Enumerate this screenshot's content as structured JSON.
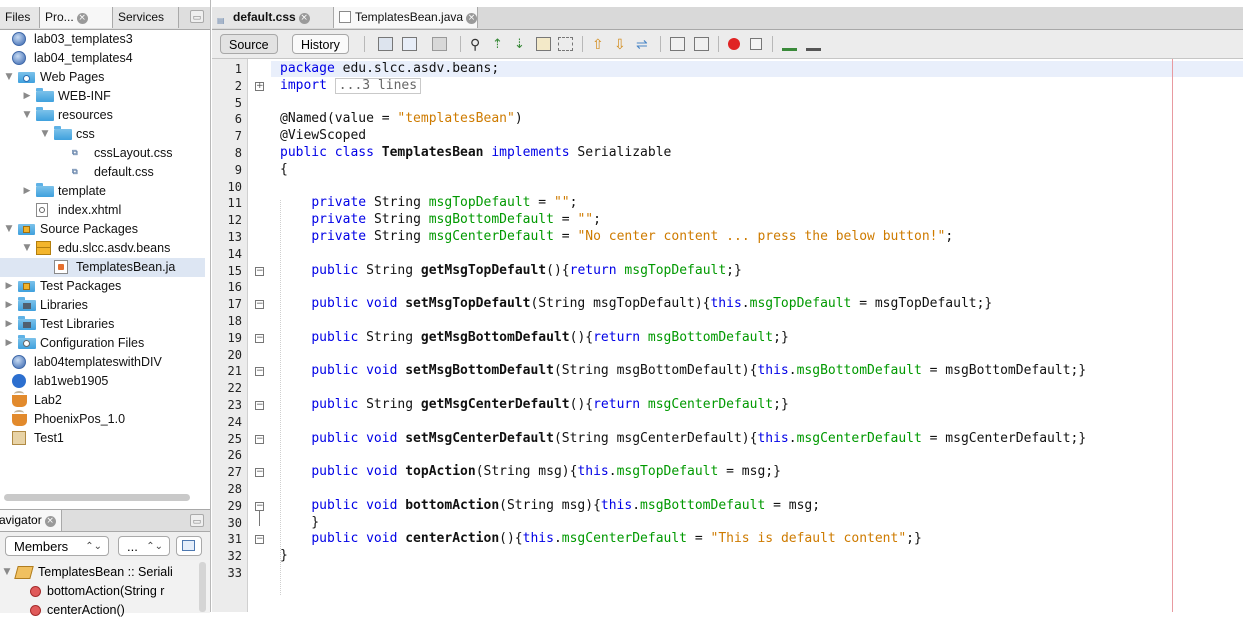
{
  "left_tabs": [
    {
      "label": "Files"
    },
    {
      "label": "Pro..."
    },
    {
      "label": "Services"
    }
  ],
  "tree": [
    {
      "label": "lab03_templates3",
      "icon": "globe-icon"
    },
    {
      "label": "lab04_templates4",
      "icon": "globe-icon"
    },
    {
      "label": "Web Pages",
      "icon": "web-pages-icon",
      "toggle": "expanded"
    },
    {
      "label": "WEB-INF",
      "icon": "folder-icon",
      "toggle": "collapsed"
    },
    {
      "label": "resources",
      "icon": "folder-icon",
      "toggle": "expanded"
    },
    {
      "label": "css",
      "icon": "folder-icon",
      "toggle": "expanded"
    },
    {
      "label": "cssLayout.css",
      "icon": "css-file-icon"
    },
    {
      "label": "default.css",
      "icon": "css-file-icon"
    },
    {
      "label": "template",
      "icon": "folder-icon",
      "toggle": "collapsed"
    },
    {
      "label": "index.xhtml",
      "icon": "xhtml-file-icon"
    },
    {
      "label": "Source Packages",
      "icon": "source-packages-icon",
      "toggle": "expanded"
    },
    {
      "label": "edu.slcc.asdv.beans",
      "icon": "package-icon",
      "toggle": "expanded"
    },
    {
      "label": "TemplatesBean.ja",
      "icon": "java-file-icon"
    },
    {
      "label": "Test Packages",
      "icon": "test-packages-icon",
      "toggle": "collapsed"
    },
    {
      "label": "Libraries",
      "icon": "libraries-icon",
      "toggle": "collapsed"
    },
    {
      "label": "Test Libraries",
      "icon": "libraries-icon",
      "toggle": "collapsed"
    },
    {
      "label": "Configuration Files",
      "icon": "config-files-icon",
      "toggle": "collapsed"
    },
    {
      "label": "lab04templateswithDIV",
      "icon": "globe-icon"
    },
    {
      "label": "lab1web1905",
      "icon": "web-project-icon"
    },
    {
      "label": "Lab2",
      "icon": "java-cup-icon"
    },
    {
      "label": "PhoenixPos_1.0",
      "icon": "java-cup-icon"
    },
    {
      "label": "Test1",
      "icon": "test-project-icon"
    }
  ],
  "navigator": {
    "title": "avigator",
    "filter_select": "Members",
    "second_select": "...",
    "items": [
      {
        "label": "TemplatesBean :: Seriali"
      },
      {
        "label": "bottomAction(String r"
      },
      {
        "label": "centerAction()"
      }
    ]
  },
  "editor_tabs": [
    {
      "label": "default.css"
    },
    {
      "label": "TemplatesBean.java"
    }
  ],
  "toolbar": {
    "source_label": "Source",
    "history_label": "History"
  },
  "code_lines": [
    {
      "n": "1",
      "seg": [
        [
          "kw",
          "package "
        ],
        [
          "",
          "edu.slcc.asdv.beans;"
        ]
      ]
    },
    {
      "n": "2",
      "seg": [
        [
          "kw",
          "import "
        ],
        [
          "chip",
          "...3 lines"
        ]
      ]
    },
    {
      "n": "5",
      "seg": []
    },
    {
      "n": "6",
      "seg": [
        [
          "",
          "@Named(value = "
        ],
        [
          "st",
          "\"templatesBean\""
        ],
        [
          "",
          ")"
        ]
      ]
    },
    {
      "n": "7",
      "seg": [
        [
          "",
          "@ViewScoped"
        ]
      ]
    },
    {
      "n": "8",
      "seg": [
        [
          "kw",
          "public class "
        ],
        [
          "b",
          "TemplatesBean "
        ],
        [
          "kw",
          "implements "
        ],
        [
          "",
          "Serializable"
        ]
      ]
    },
    {
      "n": "9",
      "seg": [
        [
          "",
          "{"
        ]
      ]
    },
    {
      "n": "10",
      "seg": []
    },
    {
      "n": "11",
      "seg": [
        [
          "",
          "    "
        ],
        [
          "kw",
          "private "
        ],
        [
          "",
          "String "
        ],
        [
          "fd",
          "msgTopDefault"
        ],
        [
          "",
          " = "
        ],
        [
          "st",
          "\"\""
        ],
        [
          "",
          ";"
        ]
      ]
    },
    {
      "n": "12",
      "seg": [
        [
          "",
          "    "
        ],
        [
          "kw",
          "private "
        ],
        [
          "",
          "String "
        ],
        [
          "fd",
          "msgBottomDefault"
        ],
        [
          "",
          " = "
        ],
        [
          "st",
          "\"\""
        ],
        [
          "",
          ";"
        ]
      ]
    },
    {
      "n": "13",
      "seg": [
        [
          "",
          "    "
        ],
        [
          "kw",
          "private "
        ],
        [
          "",
          "String "
        ],
        [
          "fd",
          "msgCenterDefault"
        ],
        [
          "",
          " = "
        ],
        [
          "st",
          "\"No center content ... press the below button!\""
        ],
        [
          "",
          ";"
        ]
      ]
    },
    {
      "n": "14",
      "seg": []
    },
    {
      "n": "15",
      "seg": [
        [
          "",
          "    "
        ],
        [
          "kw",
          "public "
        ],
        [
          "",
          "String "
        ],
        [
          "b",
          "getMsgTopDefault"
        ],
        [
          "",
          "(){"
        ],
        [
          "kw",
          "return "
        ],
        [
          "fd",
          "msgTopDefault"
        ],
        [
          "",
          ";}"
        ]
      ]
    },
    {
      "n": "16",
      "seg": []
    },
    {
      "n": "17",
      "seg": [
        [
          "",
          "    "
        ],
        [
          "kw",
          "public void "
        ],
        [
          "b",
          "setMsgTopDefault"
        ],
        [
          "",
          "(String msgTopDefault){"
        ],
        [
          "kw",
          "this"
        ],
        [
          "",
          "."
        ],
        [
          "fd",
          "msgTopDefault"
        ],
        [
          "",
          " = msgTopDefault;}"
        ]
      ]
    },
    {
      "n": "18",
      "seg": []
    },
    {
      "n": "19",
      "seg": [
        [
          "",
          "    "
        ],
        [
          "kw",
          "public "
        ],
        [
          "",
          "String "
        ],
        [
          "b",
          "getMsgBottomDefault"
        ],
        [
          "",
          "(){"
        ],
        [
          "kw",
          "return "
        ],
        [
          "fd",
          "msgBottomDefault"
        ],
        [
          "",
          ";}"
        ]
      ]
    },
    {
      "n": "20",
      "seg": []
    },
    {
      "n": "21",
      "seg": [
        [
          "",
          "    "
        ],
        [
          "kw",
          "public void "
        ],
        [
          "b",
          "setMsgBottomDefault"
        ],
        [
          "",
          "(String msgBottomDefault){"
        ],
        [
          "kw",
          "this"
        ],
        [
          "",
          "."
        ],
        [
          "fd",
          "msgBottomDefault"
        ],
        [
          "",
          " = msgBottomDefault;}"
        ]
      ]
    },
    {
      "n": "22",
      "seg": []
    },
    {
      "n": "23",
      "seg": [
        [
          "",
          "    "
        ],
        [
          "kw",
          "public "
        ],
        [
          "",
          "String "
        ],
        [
          "b",
          "getMsgCenterDefault"
        ],
        [
          "",
          "(){"
        ],
        [
          "kw",
          "return "
        ],
        [
          "fd",
          "msgCenterDefault"
        ],
        [
          "",
          ";}"
        ]
      ]
    },
    {
      "n": "24",
      "seg": []
    },
    {
      "n": "25",
      "seg": [
        [
          "",
          "    "
        ],
        [
          "kw",
          "public void "
        ],
        [
          "b",
          "setMsgCenterDefault"
        ],
        [
          "",
          "(String msgCenterDefault){"
        ],
        [
          "kw",
          "this"
        ],
        [
          "",
          "."
        ],
        [
          "fd",
          "msgCenterDefault"
        ],
        [
          "",
          " = msgCenterDefault;}"
        ]
      ]
    },
    {
      "n": "26",
      "seg": []
    },
    {
      "n": "27",
      "seg": [
        [
          "",
          "    "
        ],
        [
          "kw",
          "public void "
        ],
        [
          "b",
          "topAction"
        ],
        [
          "",
          "(String msg){"
        ],
        [
          "kw",
          "this"
        ],
        [
          "",
          "."
        ],
        [
          "fd",
          "msgTopDefault"
        ],
        [
          "",
          " = msg;}"
        ]
      ]
    },
    {
      "n": "28",
      "seg": []
    },
    {
      "n": "29",
      "seg": [
        [
          "",
          "    "
        ],
        [
          "kw",
          "public void "
        ],
        [
          "b",
          "bottomAction"
        ],
        [
          "",
          "(String msg){"
        ],
        [
          "kw",
          "this"
        ],
        [
          "",
          "."
        ],
        [
          "fd",
          "msgBottomDefault"
        ],
        [
          "",
          " = msg;"
        ]
      ]
    },
    {
      "n": "30",
      "seg": [
        [
          "",
          "    }"
        ]
      ]
    },
    {
      "n": "31",
      "seg": [
        [
          "",
          "    "
        ],
        [
          "kw",
          "public void "
        ],
        [
          "b",
          "centerAction"
        ],
        [
          "",
          "(){"
        ],
        [
          "kw",
          "this"
        ],
        [
          "",
          "."
        ],
        [
          "fd",
          "msgCenterDefault"
        ],
        [
          "",
          " = "
        ],
        [
          "st",
          "\"This is default content\""
        ],
        [
          "",
          ";}"
        ]
      ]
    },
    {
      "n": "32",
      "seg": [
        [
          "",
          "}"
        ]
      ]
    },
    {
      "n": "33",
      "seg": []
    }
  ],
  "colors": {
    "keyword": "#0000e6",
    "string": "#ce7b00",
    "field": "#009900",
    "margin_line": "#e89aa0",
    "selection": "#dde6f3"
  }
}
